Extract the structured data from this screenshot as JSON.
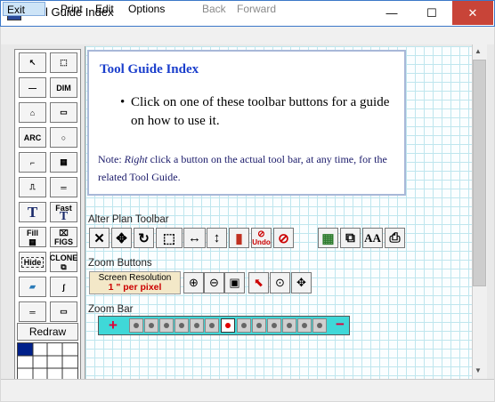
{
  "window": {
    "title": "Tool Guide Index",
    "controls": {
      "minimize": "—",
      "maximize": "☐",
      "close": "✕"
    }
  },
  "menu": {
    "items": [
      "Exit",
      "Print",
      "Edit",
      "Options",
      "Back",
      "Forward"
    ]
  },
  "info": {
    "title": "Tool Guide Index",
    "bullet": "Click on one of these toolbar buttons for a guide on how to use it.",
    "note_prefix": "Note: ",
    "note_emph": "Right",
    "note_rest": " click a button on the actual tool bar, at any time, for the related Tool Guide."
  },
  "alter": {
    "label": "Alter Plan Toolbar"
  },
  "zoom": {
    "label": "Zoom Buttons",
    "screen_res_label": "Screen Resolution",
    "screen_res_value": "1 \" per pixel"
  },
  "zoombar": {
    "label": "Zoom Bar"
  },
  "left_tools": {
    "dim": "DIM",
    "arc": "ARC",
    "fast": "Fast",
    "fill": "Fill",
    "figs": "FIGS",
    "hide": "Hide",
    "clone": "CLONE",
    "redraw": "Redraw"
  },
  "alter_buttons": [
    "✕",
    "✥",
    "↻",
    "⬚",
    "↔",
    "↕",
    "▮",
    "Undo",
    "⊘",
    "▦",
    "⧉",
    "AA",
    "⎙"
  ],
  "colors": {
    "accent": "#1a3ecc",
    "close": "#c84438",
    "zoombar": "#3fd8d8",
    "status_red": "#c00"
  }
}
